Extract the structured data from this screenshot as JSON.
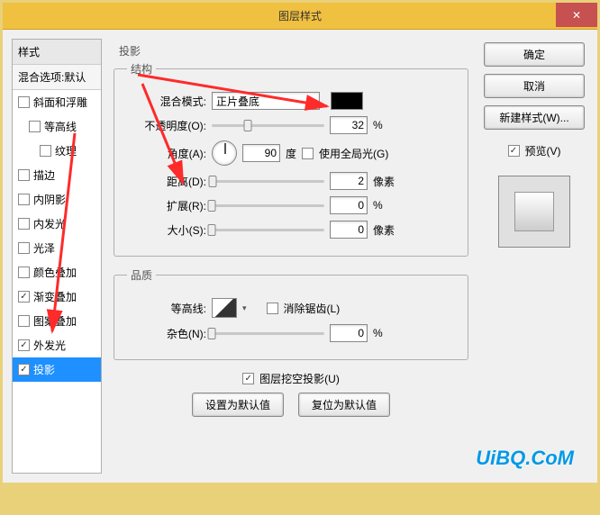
{
  "window": {
    "title": "图层样式",
    "close_icon": "✕"
  },
  "left": {
    "header": "样式",
    "blend_default": "混合选项:默认",
    "items": [
      {
        "label": "斜面和浮雕",
        "checked": false,
        "indent": 0
      },
      {
        "label": "等高线",
        "checked": false,
        "indent": 1
      },
      {
        "label": "纹理",
        "checked": false,
        "indent": 2
      },
      {
        "label": "描边",
        "checked": false,
        "indent": 0
      },
      {
        "label": "内阴影",
        "checked": false,
        "indent": 0
      },
      {
        "label": "内发光",
        "checked": false,
        "indent": 0
      },
      {
        "label": "光泽",
        "checked": false,
        "indent": 0
      },
      {
        "label": "颜色叠加",
        "checked": false,
        "indent": 0
      },
      {
        "label": "渐变叠加",
        "checked": true,
        "indent": 0
      },
      {
        "label": "图案叠加",
        "checked": false,
        "indent": 0
      },
      {
        "label": "外发光",
        "checked": true,
        "indent": 0
      },
      {
        "label": "投影",
        "checked": true,
        "indent": 0,
        "selected": true
      }
    ]
  },
  "section": {
    "dropshadow": "投影",
    "structure": "结构",
    "quality": "品质"
  },
  "labels": {
    "blend_mode": "混合模式:",
    "opacity": "不透明度(O):",
    "angle": "角度(A):",
    "deg": "度",
    "global": "使用全局光(G)",
    "distance": "距离(D):",
    "spread": "扩展(R):",
    "size": "大小(S):",
    "px": "像素",
    "pct": "%",
    "contour": "等高线:",
    "anti": "消除锯齿(L)",
    "noise": "杂色(N):",
    "knockout": "图层挖空投影(U)",
    "make_default": "设置为默认值",
    "reset_default": "复位为默认值"
  },
  "values": {
    "blend_mode": "正片叠底",
    "opacity": "32",
    "angle": "90",
    "global": false,
    "distance": "2",
    "spread": "0",
    "size": "0",
    "noise": "0",
    "anti": false,
    "knockout": true,
    "color": "#000000"
  },
  "right": {
    "ok": "确定",
    "cancel": "取消",
    "new_style": "新建样式(W)...",
    "preview": "预览(V)",
    "preview_checked": true
  },
  "watermark": "UiBQ.CoM"
}
